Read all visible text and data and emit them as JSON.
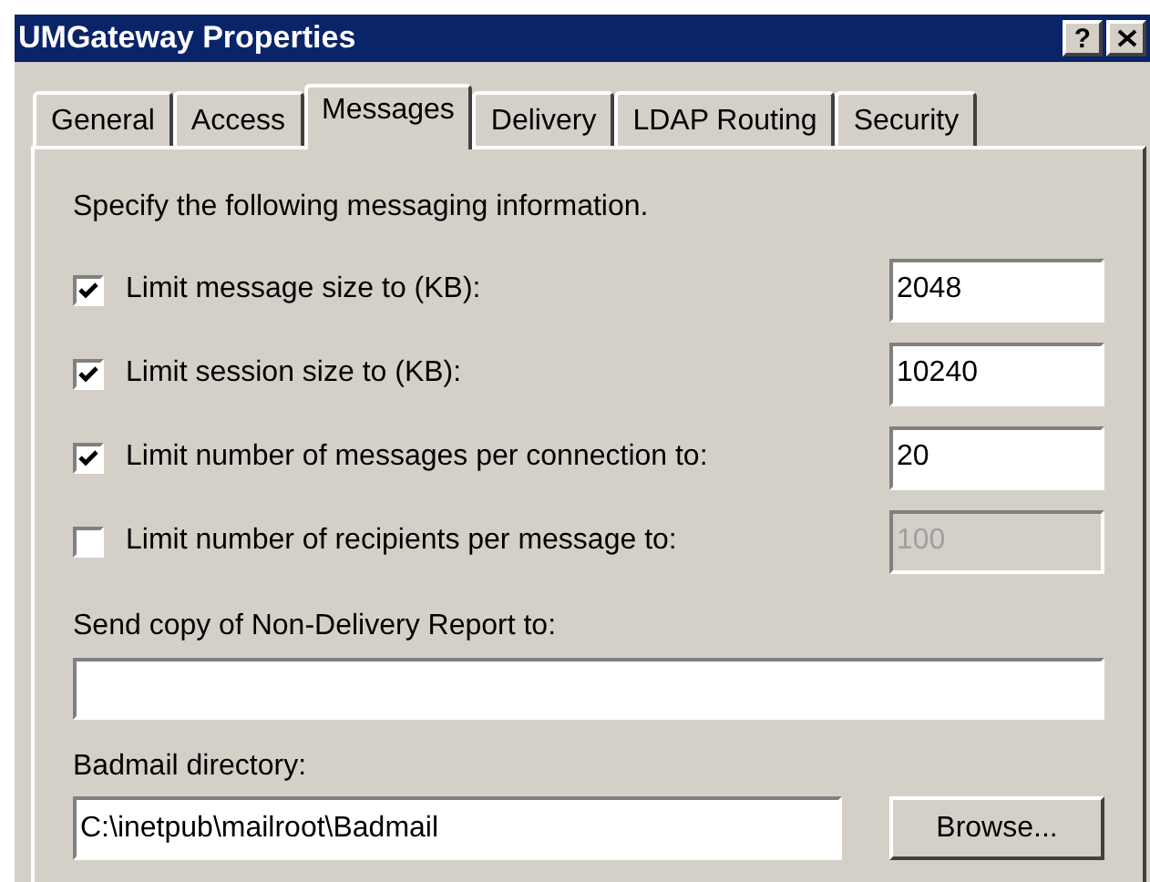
{
  "window": {
    "title": "UMGateway Properties",
    "buttons": [
      "?"
    ]
  },
  "tabs": [
    {
      "label": "General",
      "selected": false
    },
    {
      "label": "Access",
      "selected": false
    },
    {
      "label": "Messages",
      "selected": true
    },
    {
      "label": "Delivery",
      "selected": false
    },
    {
      "label": "LDAP Routing",
      "selected": false
    },
    {
      "label": "Security",
      "selected": false
    }
  ],
  "intro": "Specify the following messaging information.",
  "limits": [
    {
      "label": "Limit message size to (KB):",
      "checked": true,
      "value": "2048",
      "disabled": false
    },
    {
      "label": "Limit session size to (KB):",
      "checked": true,
      "value": "10240",
      "disabled": false
    },
    {
      "label": "Limit number of messages per connection to:",
      "checked": true,
      "value": "20",
      "disabled": false
    },
    {
      "label": "Limit number of recipients per message to:",
      "checked": false,
      "value": "100",
      "disabled": true
    }
  ],
  "ndr": {
    "label": "Send copy of Non-Delivery Report to:"
  },
  "badmail": {
    "label": "Badmail directory:",
    "value": "C:\\inetpub\\mailroot\\Badmail",
    "button": "Browse..."
  }
}
